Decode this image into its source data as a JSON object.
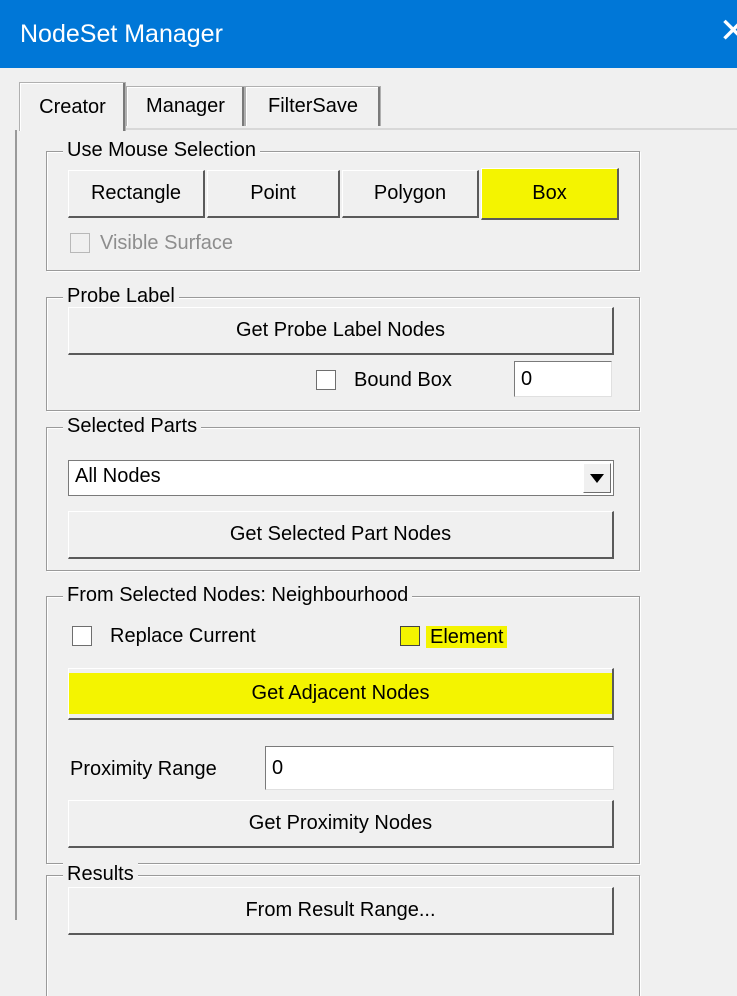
{
  "window": {
    "title": "NodeSet Manager",
    "close_glyph": "✕"
  },
  "tabs": [
    {
      "label": "Creator",
      "active": true
    },
    {
      "label": "Manager",
      "active": false
    },
    {
      "label": "FilterSave",
      "active": false
    }
  ],
  "mouse_selection": {
    "legend": "Use Mouse Selection",
    "buttons": [
      "Rectangle",
      "Point",
      "Polygon",
      "Box"
    ],
    "visible_surface_label": "Visible Surface"
  },
  "probe_label": {
    "legend": "Probe Label",
    "get_button": "Get Probe Label Nodes",
    "bound_box_label": "Bound Box",
    "bound_box_value": "0"
  },
  "selected_parts": {
    "legend": "Selected Parts",
    "dropdown_value": "All Nodes",
    "get_button": "Get Selected Part Nodes"
  },
  "neighbourhood": {
    "legend": "From Selected Nodes: Neighbourhood",
    "replace_current_label": "Replace Current",
    "element_label": "Element",
    "adjacent_button": "Get Adjacent Nodes",
    "proximity_label": "Proximity Range",
    "proximity_value": "0",
    "proximity_button": "Get Proximity Nodes"
  },
  "results": {
    "legend": "Results",
    "range_button": "From Result Range..."
  },
  "colors": {
    "titlebar": "#0077d7",
    "highlight": "#f4f400",
    "background": "#f0f0f0"
  }
}
